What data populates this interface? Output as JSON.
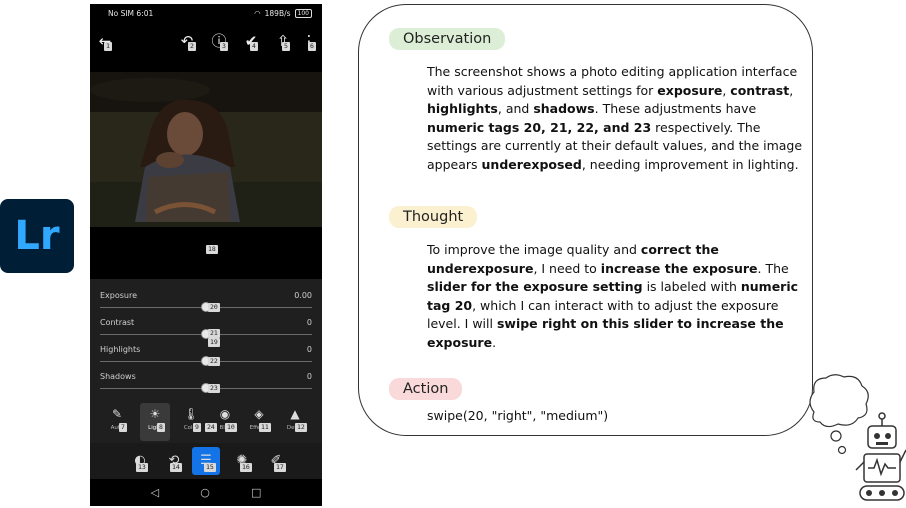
{
  "logo": {
    "text": "Lr"
  },
  "phone": {
    "status": {
      "carrier": "No SIM 6:01",
      "speed": "189B/s",
      "battery": "100"
    },
    "toolbar_tags": {
      "back": "1",
      "undo": "2",
      "help": "3",
      "done": "4",
      "share": "5",
      "more": "6"
    },
    "image_tag": "18",
    "sliders": [
      {
        "label": "Exposure",
        "value": "0.00",
        "tag": "20",
        "level": 0.5
      },
      {
        "label": "Contrast",
        "value": "0",
        "tag": "21",
        "tag2": "19",
        "level": 0.5
      },
      {
        "label": "Highlights",
        "value": "0",
        "tag": "22",
        "level": 0.5
      },
      {
        "label": "Shadows",
        "value": "0",
        "tag": "23",
        "level": 0.5
      }
    ],
    "tools": [
      {
        "label": "Auto",
        "tag": "7"
      },
      {
        "label": "Light",
        "tag": "8"
      },
      {
        "label": "Color",
        "tag": "9"
      },
      {
        "label": "Blur",
        "tag": "10",
        "tag_pre": "24"
      },
      {
        "label": "Effects",
        "tag": "11"
      },
      {
        "label": "Detail",
        "tag": "12"
      }
    ],
    "bottom_tags": [
      "13",
      "14",
      "15",
      "16",
      "17"
    ]
  },
  "reasoning": {
    "observation_title": "Observation",
    "thought_title": "Thought",
    "action_title": "Action",
    "obs": {
      "t1": "The screenshot shows a photo editing application interface with various adjustment settings for ",
      "b1": "exposure",
      "t2": ", ",
      "b2": "contrast",
      "t3": ", ",
      "b3": "highlights",
      "t4": ", and ",
      "b4": "shadows",
      "t5": ". These adjustments have ",
      "b5": "numeric tags 20, 21, 22, and 23",
      "t6": " respectively. The settings are currently at their default values, and the image appears ",
      "b6": "underexposed",
      "t7": ", needing improvement in lighting."
    },
    "thought": {
      "t1": "To improve the image quality and ",
      "b1": "correct the underexposure",
      "t2": ", I need to ",
      "b2": "increase the exposure",
      "t3": ". The ",
      "b3": "slider for the exposure setting",
      "t4": " is labeled with ",
      "b4": "numeric tag 20",
      "t5": ", which I can interact with to adjust the exposure level. I will ",
      "b5": "swipe right on this slider to increase the exposure",
      "t6": "."
    },
    "action": "swipe(20, \"right\", \"medium\")"
  }
}
